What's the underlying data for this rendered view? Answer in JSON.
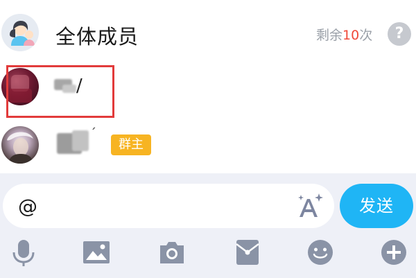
{
  "member_list": {
    "all_members": {
      "title": "全体成员",
      "remaining_prefix": "剩余",
      "remaining_count": "10",
      "remaining_suffix": "次",
      "help_label": "?"
    },
    "members": [
      {
        "name_visible": "/",
        "badge": ""
      },
      {
        "name_visible": "",
        "badge": "群主"
      }
    ]
  },
  "composer": {
    "input_value": "@",
    "send_label": "发送"
  },
  "toolbar": {
    "icons": [
      "microphone-icon",
      "image-icon",
      "camera-icon",
      "red-packet-icon",
      "emoji-icon",
      "plus-icon"
    ]
  },
  "colors": {
    "accent": "#1fb5f5",
    "highlight": "#e23b3b",
    "owner_badge": "#f7b422",
    "count": "#f04a3a",
    "icon": "#8a93a6",
    "background_bottom": "#eef0f7"
  }
}
